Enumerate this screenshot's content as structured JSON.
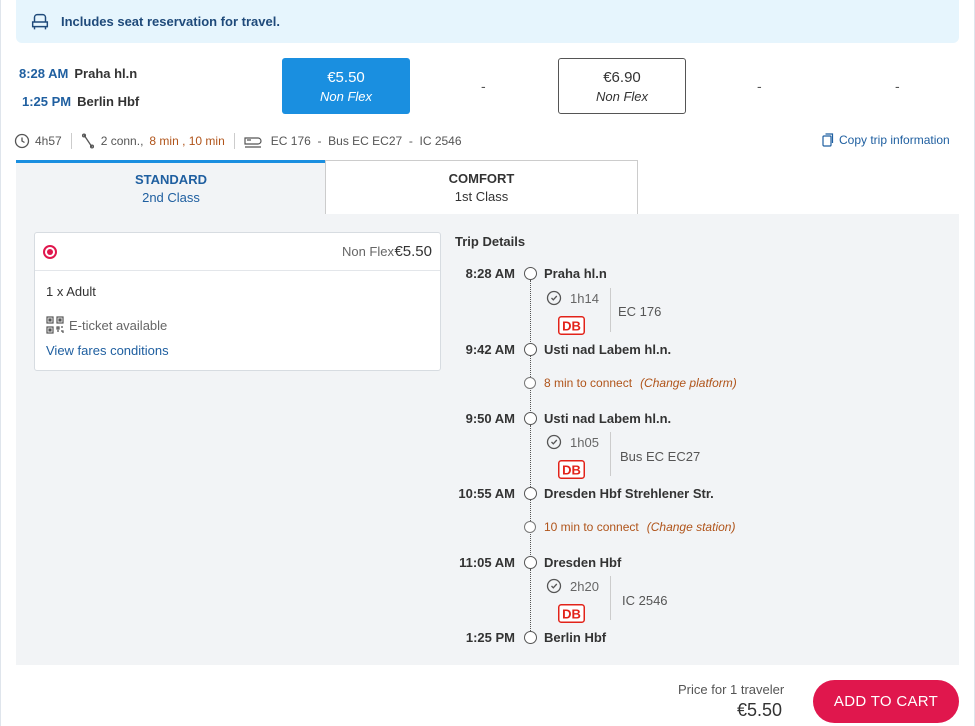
{
  "banner": {
    "text": "Includes seat reservation for travel.",
    "icon": "seat-icon"
  },
  "trip": {
    "departure_time": "8:28 AM",
    "departure_station": "Praha hl.n",
    "arrival_time": "1:25 PM",
    "arrival_station": "Berlin Hbf"
  },
  "fares": {
    "selected": {
      "price": "€5.50",
      "type": "Non Flex"
    },
    "other": {
      "price": "€6.90",
      "type": "Non Flex"
    },
    "unavailable": [
      "-",
      "-",
      "-"
    ]
  },
  "info": {
    "duration": "4h57",
    "connections": "2 conn.,",
    "connection_times": "8 min , 10 min",
    "trains": "EC 176  -  Bus EC EC27  -  IC 2546",
    "copy_label": "Copy trip information"
  },
  "tabs": [
    {
      "title": "STANDARD",
      "subtitle": "2nd Class"
    },
    {
      "title": "COMFORT",
      "subtitle": "1st Class"
    }
  ],
  "fare_card": {
    "fare_type": "Non Flex",
    "price": "€5.50",
    "passengers": "1 x Adult",
    "eticket": "E-ticket available",
    "conditions_link": "View fares conditions"
  },
  "trip_details": {
    "title": "Trip Details",
    "stops": [
      {
        "time": "8:28 AM",
        "name": "Praha hl.n"
      },
      {
        "time": "9:42 AM",
        "name": "Usti nad Labem hl.n."
      },
      {
        "time": "9:50 AM",
        "name": "Usti nad Labem hl.n."
      },
      {
        "time": "10:55 AM",
        "name": "Dresden Hbf Strehlener Str."
      },
      {
        "time": "11:05 AM",
        "name": "Dresden Hbf"
      },
      {
        "time": "1:25 PM",
        "name": "Berlin Hbf"
      }
    ],
    "legs": [
      {
        "duration": "1h14",
        "service": "EC 176",
        "operator": "DB"
      },
      {
        "duration": "1h05",
        "service": "Bus EC EC27",
        "operator": "DB"
      },
      {
        "duration": "2h20",
        "service": "IC 2546",
        "operator": "DB"
      }
    ],
    "connections": [
      {
        "text": "8 min to connect",
        "note": "(Change platform)"
      },
      {
        "text": "10 min to connect",
        "note": "(Change station)"
      }
    ]
  },
  "footer": {
    "price_label": "Price for 1 traveler",
    "total": "€5.50",
    "cart_button": "ADD TO CART"
  },
  "colors": {
    "accent": "#1a8fe0",
    "brand": "#e0174d",
    "link": "#1f5fa0",
    "warning": "#b0541a"
  }
}
